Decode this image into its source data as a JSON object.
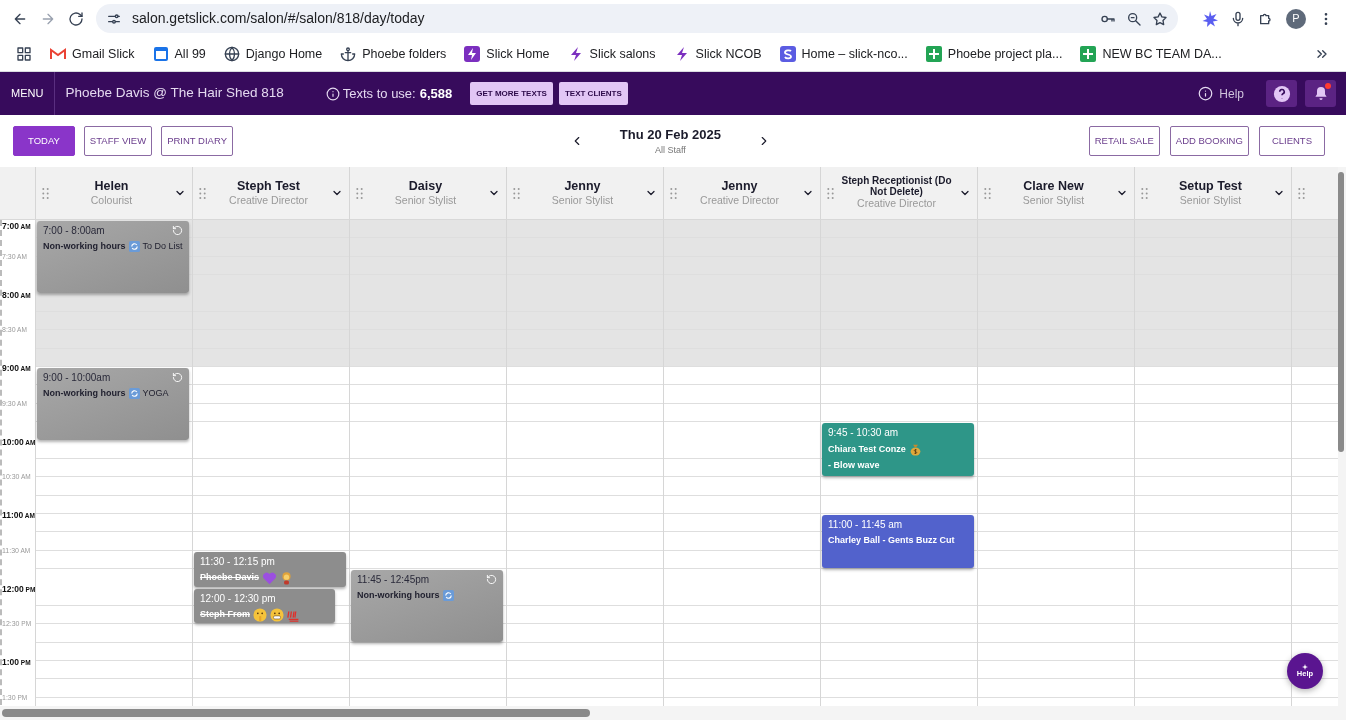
{
  "browser": {
    "url": "salon.getslick.com/salon/#/salon/818/day/today",
    "profile_initial": "P",
    "bookmarks": [
      {
        "label": "Gmail Slick",
        "kind": "gmail"
      },
      {
        "label": "All 99",
        "kind": "calendar"
      },
      {
        "label": "Django Home",
        "kind": "globe"
      },
      {
        "label": "Phoebe folders",
        "kind": "anchor"
      },
      {
        "label": "Slick Home",
        "kind": "bolt-square"
      },
      {
        "label": "Slick salons",
        "kind": "bolt"
      },
      {
        "label": "Slick NCOB",
        "kind": "bolt"
      },
      {
        "label": "Home – slick-nco...",
        "kind": "s-square"
      },
      {
        "label": "Phoebe project pla...",
        "kind": "sheet"
      },
      {
        "label": "NEW BC TEAM DA...",
        "kind": "sheet"
      }
    ]
  },
  "header": {
    "menu": "MENU",
    "salon": "Phoebe Davis @ The Hair Shed 818",
    "texts_label": "Texts to use:",
    "texts_count": "6,588",
    "buttons": [
      "GET MORE TEXTS",
      "TEXT CLIENTS"
    ],
    "help": "Help",
    "notifications_unread": true
  },
  "toolbar": {
    "views": [
      {
        "label": "TODAY",
        "selected": true
      },
      {
        "label": "STAFF VIEW",
        "selected": false
      },
      {
        "label": "PRINT DIARY",
        "selected": false
      }
    ],
    "date": "Thu 20 Feb 2025",
    "scope": "All Staff",
    "actions": [
      "RETAIL SALE",
      "ADD BOOKING",
      "CLIENTS"
    ]
  },
  "times": [
    {
      "label": "7:00",
      "suffix": "AM",
      "kind": "hour"
    },
    {
      "label": "7:30",
      "suffix": "AM",
      "kind": "half"
    },
    {
      "label": "8:00",
      "suffix": "AM",
      "kind": "hour"
    },
    {
      "label": "8:30",
      "suffix": "AM",
      "kind": "half"
    },
    {
      "label": "9:00",
      "suffix": "AM",
      "kind": "hour"
    },
    {
      "label": "9:30",
      "suffix": "AM",
      "kind": "half"
    },
    {
      "label": "10:00",
      "suffix": "AM",
      "kind": "hour"
    },
    {
      "label": "10:30",
      "suffix": "AM",
      "kind": "half"
    },
    {
      "label": "11:00",
      "suffix": "AM",
      "kind": "hour"
    },
    {
      "label": "11:30",
      "suffix": "AM",
      "kind": "half"
    },
    {
      "label": "12:00",
      "suffix": "PM",
      "kind": "hour"
    },
    {
      "label": "12:30",
      "suffix": "PM",
      "kind": "half"
    },
    {
      "label": "1:00",
      "suffix": "PM",
      "kind": "hour"
    },
    {
      "label": "1:30",
      "suffix": "PM",
      "kind": "half"
    }
  ],
  "staff": [
    {
      "name": "Helen",
      "role": "Colourist",
      "events": [
        {
          "time": "7:00 - 8:00am",
          "kind": "nonworking",
          "cancelled": false,
          "lines": [
            [
              {
                "kind": "text",
                "text": "Non-working hours",
                "bold": true
              },
              {
                "kind": "repeat"
              },
              {
                "kind": "text",
                "text": "To Do List",
                "bold": false
              }
            ]
          ]
        },
        {
          "time": "9:00 - 10:00am",
          "kind": "nonworking",
          "cancelled": false,
          "lines": [
            [
              {
                "kind": "text",
                "text": "Non-working hours",
                "bold": true
              },
              {
                "kind": "repeat"
              },
              {
                "kind": "text",
                "text": "YOGA",
                "bold": false
              }
            ]
          ]
        }
      ]
    },
    {
      "name": "Steph Test",
      "role": "Creative Director",
      "events": [
        {
          "time": "11:30 - 12:15 pm",
          "kind": "cancelled-booking",
          "cancelled": true,
          "lines": [
            [
              {
                "kind": "text",
                "text": "Phoebe Davis",
                "bold": true
              },
              {
                "kind": "heart"
              },
              {
                "kind": "person"
              }
            ]
          ]
        },
        {
          "time": "12:00 - 12:30 pm",
          "kind": "cancelled-booking",
          "cancelled": true,
          "lines": [
            [
              {
                "kind": "text",
                "text": "Steph From",
                "bold": true
              },
              {
                "kind": "shush"
              },
              {
                "kind": "grimace"
              },
              {
                "kind": "hundred"
              }
            ]
          ]
        }
      ]
    },
    {
      "name": "Daisy",
      "role": "Senior Stylist",
      "events": [
        {
          "time": "11:45 - 12:45pm",
          "kind": "nonworking",
          "cancelled": false,
          "lines": [
            [
              {
                "kind": "text",
                "text": "Non-working hours",
                "bold": true
              },
              {
                "kind": "repeat"
              }
            ]
          ]
        }
      ]
    },
    {
      "name": "Jenny",
      "role": "Senior Stylist"
    },
    {
      "name": "Jenny",
      "role": "Creative Director"
    },
    {
      "name": "Steph Receptionist (Do Not Delete)",
      "role": "Creative Director",
      "events": [
        {
          "time": "9:45 - 10:30 am",
          "kind": "booking",
          "color": "#2e9688",
          "cancelled": false,
          "lines": [
            [
              {
                "kind": "text",
                "text": "Chiara Test Conze",
                "bold": true
              },
              {
                "kind": "moneybag"
              }
            ],
            [
              {
                "kind": "text",
                "text": "- Blow wave",
                "bold": true
              }
            ]
          ]
        },
        {
          "time": "11:00 - 11:45 am",
          "kind": "booking",
          "color": "#5262cc",
          "cancelled": false,
          "lines": [
            [
              {
                "kind": "text",
                "text": "Charley Ball - Gents Buzz Cut",
                "bold": true
              }
            ]
          ]
        }
      ]
    },
    {
      "name": "Clare New",
      "role": "Senior Stylist"
    },
    {
      "name": "Setup Test",
      "role": "Senior Stylist"
    }
  ],
  "help_button": "Help"
}
